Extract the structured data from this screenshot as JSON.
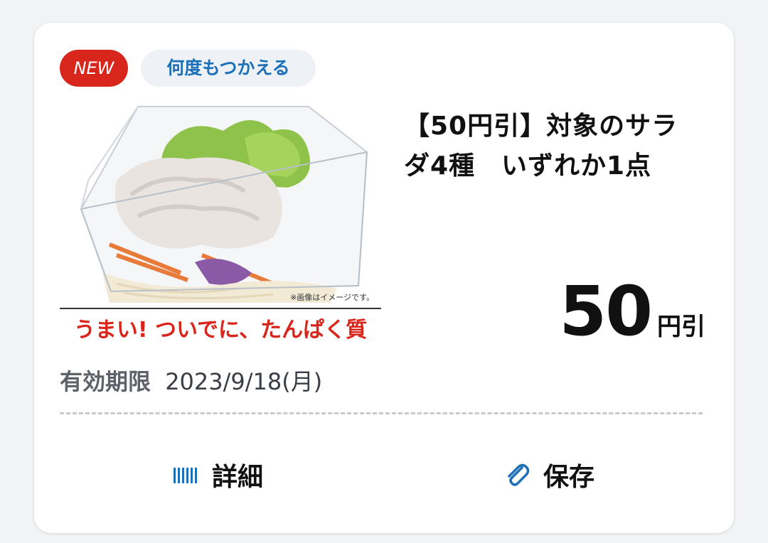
{
  "badges": {
    "new": "NEW",
    "reuse": "何度もつかえる"
  },
  "coupon": {
    "title": "【50円引】対象のサラダ4種　いずれか1点",
    "discount_value": "50",
    "discount_unit": "円引"
  },
  "image": {
    "caption_note": "※画像はイメージです。",
    "slogan": "うまい! ついでに、たんぱく質"
  },
  "expiry": {
    "label": "有効期限",
    "date": "2023/9/18(月)"
  },
  "actions": {
    "detail_label": "詳細",
    "save_label": "保存"
  },
  "colors": {
    "new_badge": "#d9261c",
    "accent_blue": "#1d6fb8",
    "slogan_red": "#d9261c"
  },
  "icons": {
    "detail": "barcode-icon",
    "save": "paperclip-icon"
  }
}
